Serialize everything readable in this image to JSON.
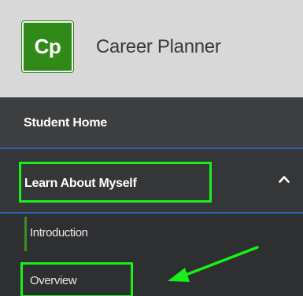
{
  "header": {
    "logo_text": "Cp",
    "app_title": "Career Planner",
    "logo_color": "#2f8a1a"
  },
  "nav": {
    "home_label": "Student Home",
    "section_label": "Learn About Myself",
    "section_expanded": true,
    "section_icon": "chevron-up-icon",
    "sub_items": [
      {
        "label": "Introduction",
        "active": true
      },
      {
        "label": "Overview",
        "active": false
      }
    ]
  },
  "annotations": {
    "highlight_color": "#19f019",
    "arrow_icon": "arrow-pointer-icon"
  }
}
